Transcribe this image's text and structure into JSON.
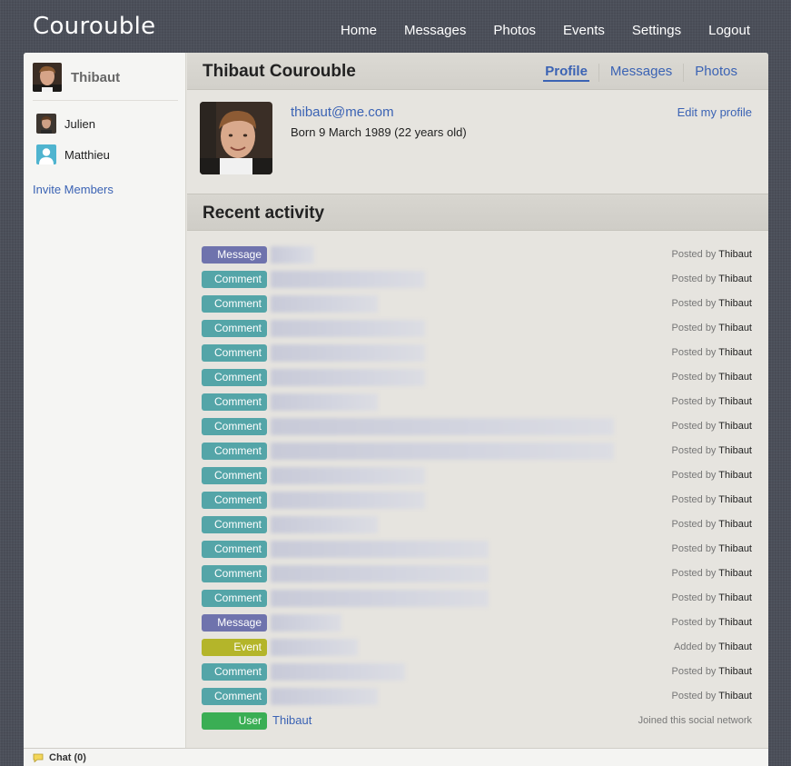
{
  "app": {
    "brand": "Courouble",
    "nav": [
      "Home",
      "Messages",
      "Photos",
      "Events",
      "Settings",
      "Logout"
    ]
  },
  "sidebar": {
    "user_name": "Thibaut",
    "friends": [
      {
        "name": "Julien",
        "avatar": "photo-avatar"
      },
      {
        "name": "Matthieu",
        "avatar": "default-avatar"
      }
    ],
    "invite_label": "Invite Members"
  },
  "chat": {
    "label": "Chat (0)",
    "icon": "speech-bubble-icon"
  },
  "profile": {
    "title": "Thibaut Courouble",
    "tabs": [
      "Profile",
      "Messages",
      "Photos"
    ],
    "active_tab": "Profile",
    "email": "thibaut@me.com",
    "born": "Born 9 March 1989 (22 years old)",
    "edit_label": "Edit my profile"
  },
  "activity": {
    "heading": "Recent activity",
    "colors": {
      "Message": "#6f73ad",
      "Comment": "#54a5a8",
      "Event": "#b4b52a",
      "User": "#3aae54"
    },
    "items": [
      {
        "type": "Message",
        "meta_prefix": "Posted by",
        "author": "Thibaut"
      },
      {
        "type": "Comment",
        "meta_prefix": "Posted by",
        "author": "Thibaut"
      },
      {
        "type": "Comment",
        "meta_prefix": "Posted by",
        "author": "Thibaut"
      },
      {
        "type": "Comment",
        "meta_prefix": "Posted by",
        "author": "Thibaut"
      },
      {
        "type": "Comment",
        "meta_prefix": "Posted by",
        "author": "Thibaut"
      },
      {
        "type": "Comment",
        "meta_prefix": "Posted by",
        "author": "Thibaut"
      },
      {
        "type": "Comment",
        "meta_prefix": "Posted by",
        "author": "Thibaut"
      },
      {
        "type": "Comment",
        "meta_prefix": "Posted by",
        "author": "Thibaut"
      },
      {
        "type": "Comment",
        "meta_prefix": "Posted by",
        "author": "Thibaut"
      },
      {
        "type": "Comment",
        "meta_prefix": "Posted by",
        "author": "Thibaut"
      },
      {
        "type": "Comment",
        "meta_prefix": "Posted by",
        "author": "Thibaut"
      },
      {
        "type": "Comment",
        "meta_prefix": "Posted by",
        "author": "Thibaut"
      },
      {
        "type": "Comment",
        "meta_prefix": "Posted by",
        "author": "Thibaut"
      },
      {
        "type": "Comment",
        "meta_prefix": "Posted by",
        "author": "Thibaut"
      },
      {
        "type": "Comment",
        "meta_prefix": "Posted by",
        "author": "Thibaut"
      },
      {
        "type": "Message",
        "meta_prefix": "Posted by",
        "author": "Thibaut"
      },
      {
        "type": "Event",
        "meta_prefix": "Added by",
        "author": "Thibaut"
      },
      {
        "type": "Comment",
        "meta_prefix": "Posted by",
        "author": "Thibaut"
      },
      {
        "type": "Comment",
        "meta_prefix": "Posted by",
        "author": "Thibaut"
      },
      {
        "type": "User",
        "text": "Thibaut",
        "meta_prefix": "Joined this social network",
        "author": ""
      }
    ]
  }
}
